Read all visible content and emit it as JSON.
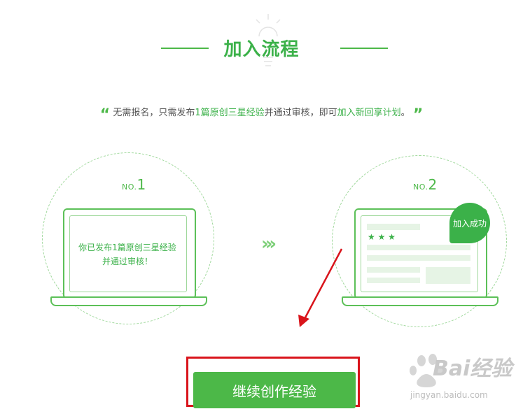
{
  "page": {
    "title": "加入流程"
  },
  "intro": {
    "open_quote": "“",
    "part1": "无需报名，只需发布",
    "highlight1": "1篇原创三星经验",
    "part2": "并通过审核，即可",
    "highlight2": "加入新回享计划",
    "part3": "。",
    "close_quote": "”"
  },
  "steps": [
    {
      "no_prefix": "NO.",
      "no_num": "1",
      "screen_line1": "你已发布1篇原创三星经验",
      "screen_line2": "并通过审核！"
    },
    {
      "no_prefix": "NO.",
      "no_num": "2",
      "badge": "加入成功",
      "stars": "★ ★ ★"
    }
  ],
  "arrow_glyph": "›››",
  "continue_button": {
    "label": "继续创作经验"
  },
  "watermark": {
    "brand": "Bai经验",
    "url": "jingyan.baidu.com"
  },
  "colors": {
    "accent": "#4cb848",
    "annotation": "#d9141b"
  }
}
